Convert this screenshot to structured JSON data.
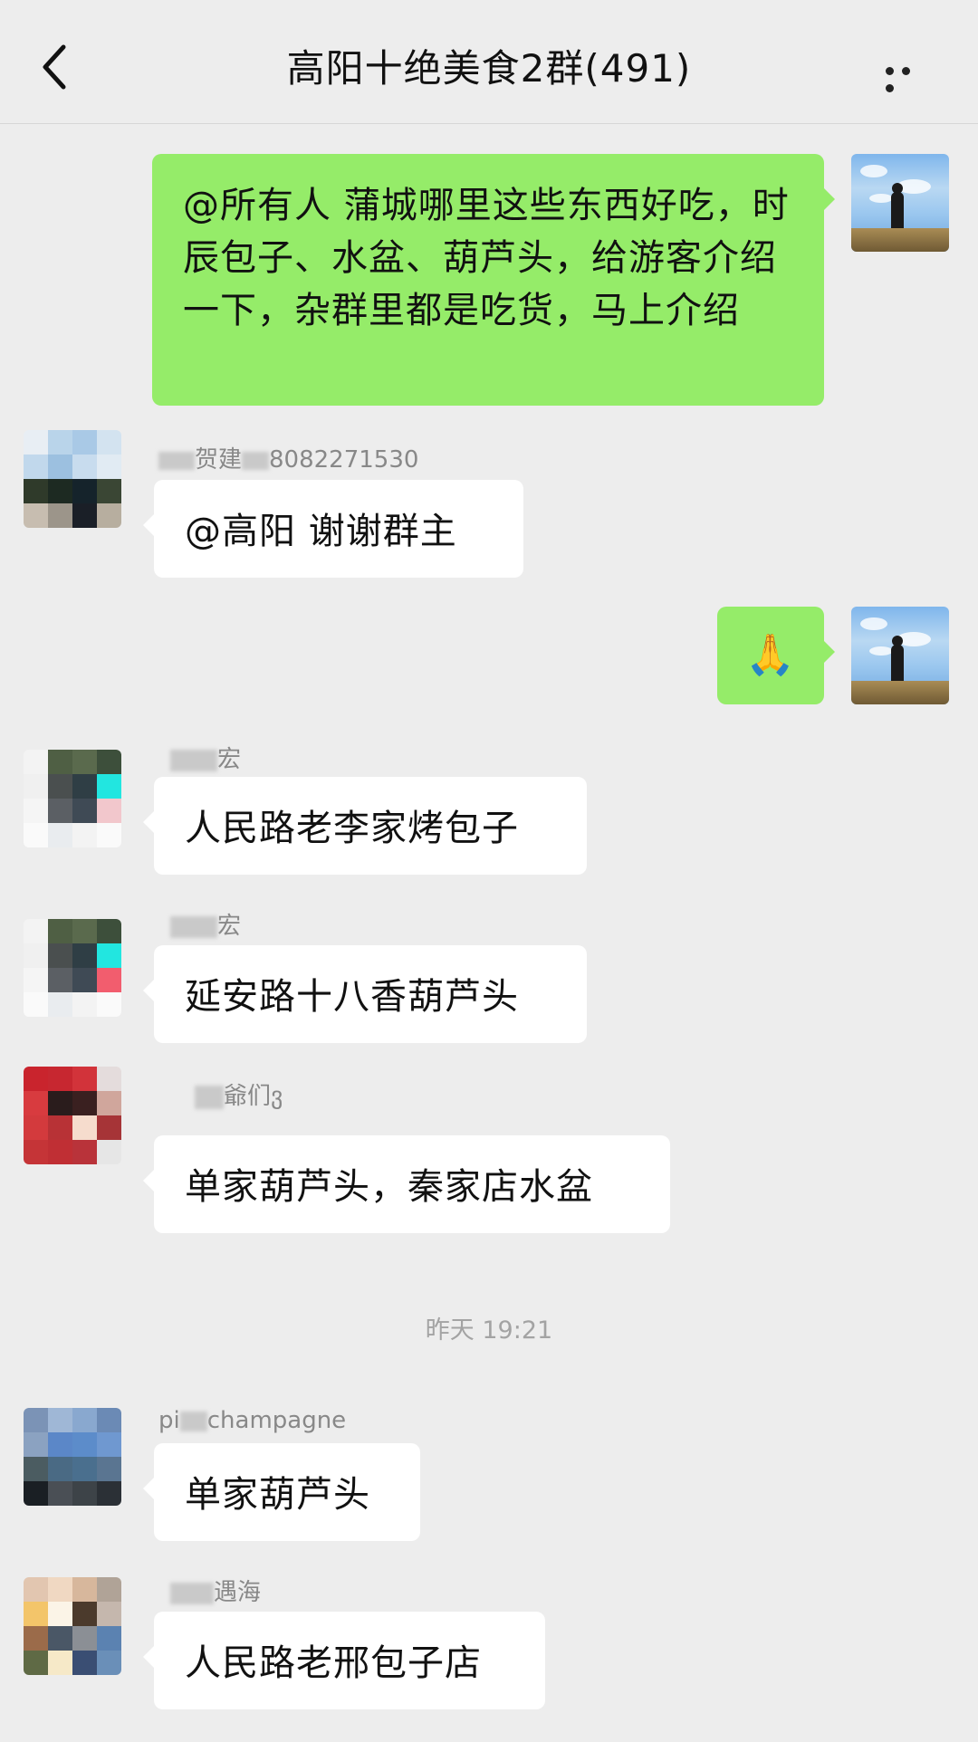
{
  "header": {
    "title": "高阳十绝美食2群(491)"
  },
  "messages": [
    {
      "side": "out",
      "text": "@所有人  蒲城哪里这些东西好吃，时辰包子、水盆、葫芦头，给游客介绍一下，杂群里都是吃货，马上介绍"
    },
    {
      "side": "in",
      "sender": "贺建…8082271530",
      "text": "@高阳  谢谢群主"
    },
    {
      "side": "out",
      "text": "🙏"
    },
    {
      "side": "in",
      "sender": "宏",
      "text": "人民路老李家烤包子"
    },
    {
      "side": "in",
      "sender": "宏",
      "text": "延安路十八香葫芦头"
    },
    {
      "side": "in",
      "sender": "爺们ვ",
      "text": "单家葫芦头，秦家店水盆"
    },
    {
      "side": "in",
      "sender": "champagne",
      "text": "单家葫芦头"
    },
    {
      "side": "in",
      "sender": "遇海",
      "text": "人民路老邢包子店"
    }
  ],
  "timestamp": "昨天 19:21",
  "sender_labels": {
    "m2_prefix": "贺建",
    "m2_suffix": "8082271530",
    "m4": "宏",
    "m5": "宏",
    "m6": "爺们ვ",
    "m7_prefix": "pi",
    "m7_suffix": "champagne",
    "m8": "遇海"
  }
}
